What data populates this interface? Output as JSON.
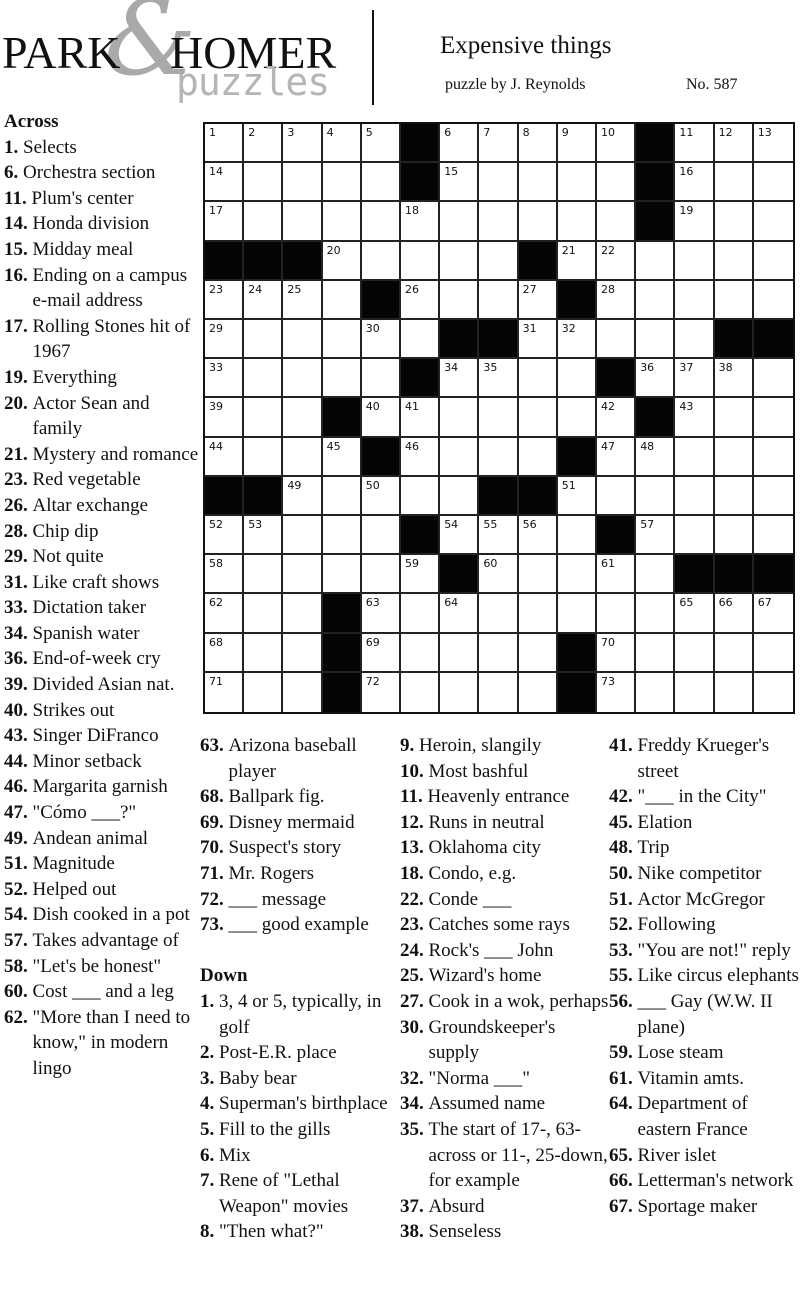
{
  "header": {
    "logo_park": "PARK",
    "logo_amp": "&",
    "logo_homer": "HOMER",
    "logo_puzzles": "puzzles",
    "title": "Expensive things",
    "byline": "puzzle by J. Reynolds",
    "puzzle_number": "No. 587"
  },
  "colors": {
    "black_square": "#050505",
    "logo_gray": "#a9a9a9"
  },
  "grid": {
    "size": 15,
    "blacks": [
      [
        0,
        5
      ],
      [
        0,
        11
      ],
      [
        1,
        5
      ],
      [
        1,
        11
      ],
      [
        2,
        11
      ],
      [
        3,
        0
      ],
      [
        3,
        1
      ],
      [
        3,
        2
      ],
      [
        3,
        8
      ],
      [
        4,
        4
      ],
      [
        4,
        9
      ],
      [
        5,
        6
      ],
      [
        5,
        7
      ],
      [
        5,
        13
      ],
      [
        5,
        14
      ],
      [
        6,
        5
      ],
      [
        6,
        10
      ],
      [
        7,
        3
      ],
      [
        7,
        11
      ],
      [
        8,
        4
      ],
      [
        8,
        9
      ],
      [
        9,
        0
      ],
      [
        9,
        1
      ],
      [
        9,
        7
      ],
      [
        9,
        8
      ],
      [
        10,
        5
      ],
      [
        10,
        10
      ],
      [
        11,
        6
      ],
      [
        11,
        12
      ],
      [
        11,
        13
      ],
      [
        11,
        14
      ],
      [
        12,
        3
      ],
      [
        13,
        3
      ],
      [
        13,
        9
      ],
      [
        14,
        3
      ],
      [
        14,
        9
      ]
    ],
    "numbers": [
      [
        0,
        0,
        1
      ],
      [
        0,
        1,
        2
      ],
      [
        0,
        2,
        3
      ],
      [
        0,
        3,
        4
      ],
      [
        0,
        4,
        5
      ],
      [
        0,
        6,
        6
      ],
      [
        0,
        7,
        7
      ],
      [
        0,
        8,
        8
      ],
      [
        0,
        9,
        9
      ],
      [
        0,
        10,
        10
      ],
      [
        0,
        12,
        11
      ],
      [
        0,
        13,
        12
      ],
      [
        0,
        14,
        13
      ],
      [
        1,
        0,
        14
      ],
      [
        1,
        6,
        15
      ],
      [
        1,
        12,
        16
      ],
      [
        2,
        0,
        17
      ],
      [
        2,
        5,
        18
      ],
      [
        2,
        12,
        19
      ],
      [
        3,
        3,
        20
      ],
      [
        3,
        9,
        21
      ],
      [
        3,
        10,
        22
      ],
      [
        4,
        0,
        23
      ],
      [
        4,
        1,
        24
      ],
      [
        4,
        2,
        25
      ],
      [
        4,
        5,
        26
      ],
      [
        4,
        8,
        27
      ],
      [
        4,
        10,
        28
      ],
      [
        5,
        0,
        29
      ],
      [
        5,
        4,
        30
      ],
      [
        5,
        8,
        31
      ],
      [
        5,
        9,
        32
      ],
      [
        6,
        0,
        33
      ],
      [
        6,
        6,
        34
      ],
      [
        6,
        7,
        35
      ],
      [
        6,
        11,
        36
      ],
      [
        6,
        12,
        37
      ],
      [
        6,
        13,
        38
      ],
      [
        7,
        0,
        39
      ],
      [
        7,
        4,
        40
      ],
      [
        7,
        5,
        41
      ],
      [
        7,
        10,
        42
      ],
      [
        7,
        12,
        43
      ],
      [
        8,
        0,
        44
      ],
      [
        8,
        3,
        45
      ],
      [
        8,
        5,
        46
      ],
      [
        8,
        10,
        47
      ],
      [
        8,
        11,
        48
      ],
      [
        9,
        2,
        49
      ],
      [
        9,
        4,
        50
      ],
      [
        9,
        9,
        51
      ],
      [
        10,
        0,
        52
      ],
      [
        10,
        1,
        53
      ],
      [
        10,
        6,
        54
      ],
      [
        10,
        7,
        55
      ],
      [
        10,
        8,
        56
      ],
      [
        10,
        11,
        57
      ],
      [
        11,
        0,
        58
      ],
      [
        11,
        5,
        59
      ],
      [
        11,
        7,
        60
      ],
      [
        11,
        10,
        61
      ],
      [
        12,
        0,
        62
      ],
      [
        12,
        4,
        63
      ],
      [
        12,
        6,
        64
      ],
      [
        12,
        12,
        65
      ],
      [
        12,
        13,
        66
      ],
      [
        12,
        14,
        67
      ],
      [
        13,
        0,
        68
      ],
      [
        13,
        4,
        69
      ],
      [
        13,
        10,
        70
      ],
      [
        14,
        0,
        71
      ],
      [
        14,
        4,
        72
      ],
      [
        14,
        10,
        73
      ]
    ]
  },
  "across_heading": "Across",
  "down_heading": "Down",
  "columns": [
    [
      {
        "h": "Across"
      },
      {
        "n": "1.",
        "t": "Selects"
      },
      {
        "n": "6.",
        "t": "Orchestra section"
      },
      {
        "n": "11.",
        "t": "Plum's center"
      },
      {
        "n": "14.",
        "t": "Honda division"
      },
      {
        "n": "15.",
        "t": "Midday meal"
      },
      {
        "n": "16.",
        "t": "Ending on a campus e-mail address"
      },
      {
        "n": "17.",
        "t": "Rolling Stones hit of 1967"
      },
      {
        "n": "19.",
        "t": "Everything"
      },
      {
        "n": "20.",
        "t": "Actor Sean and family"
      },
      {
        "n": "21.",
        "t": "Mystery and romance"
      },
      {
        "n": "23.",
        "t": "Red vegetable"
      },
      {
        "n": "26.",
        "t": "Altar exchange"
      },
      {
        "n": "28.",
        "t": "Chip dip"
      },
      {
        "n": "29.",
        "t": "Not quite"
      },
      {
        "n": "31.",
        "t": "Like craft shows"
      },
      {
        "n": "33.",
        "t": "Dictation taker"
      },
      {
        "n": "34.",
        "t": "Spanish water"
      },
      {
        "n": "36.",
        "t": "End-of-week cry"
      },
      {
        "n": "39.",
        "t": "Divided Asian nat."
      },
      {
        "n": "40.",
        "t": "Strikes out"
      },
      {
        "n": "43.",
        "t": "Singer DiFranco"
      },
      {
        "n": "44.",
        "t": "Minor setback"
      },
      {
        "n": "46.",
        "t": "Margarita garnish"
      },
      {
        "n": "47.",
        "t": "\"Cómo ___?\""
      },
      {
        "n": "49.",
        "t": "Andean animal"
      },
      {
        "n": "51.",
        "t": "Magnitude"
      },
      {
        "n": "52.",
        "t": "Helped out"
      },
      {
        "n": "54.",
        "t": "Dish cooked in a pot"
      },
      {
        "n": "57.",
        "t": "Takes advantage of"
      },
      {
        "n": "58.",
        "t": "\"Let's be honest\""
      },
      {
        "n": "60.",
        "t": "Cost ___ and a leg"
      },
      {
        "n": "62.",
        "t": "\"More than I need to know,\" in modern lingo"
      }
    ],
    [
      {
        "n": "63.",
        "t": "Arizona baseball player"
      },
      {
        "n": "68.",
        "t": "Ballpark fig."
      },
      {
        "n": "69.",
        "t": "Disney mermaid"
      },
      {
        "n": "70.",
        "t": "Suspect's story"
      },
      {
        "n": "71.",
        "t": "Mr. Rogers"
      },
      {
        "n": "72.",
        "t": "___ message"
      },
      {
        "n": "73.",
        "t": "___ good example"
      },
      {
        "gap": true
      },
      {
        "h": "Down"
      },
      {
        "n": "1.",
        "t": "3, 4 or 5, typically, in golf"
      },
      {
        "n": "2.",
        "t": "Post-E.R. place"
      },
      {
        "n": "3.",
        "t": "Baby bear"
      },
      {
        "n": "4.",
        "t": "Superman's birthplace"
      },
      {
        "n": "5.",
        "t": "Fill to the gills"
      },
      {
        "n": "6.",
        "t": "Mix"
      },
      {
        "n": "7.",
        "t": "Rene of \"Lethal Weapon\" movies"
      },
      {
        "n": "8.",
        "t": "\"Then what?\""
      }
    ],
    [
      {
        "n": "9.",
        "t": "Heroin, slangily"
      },
      {
        "n": "10.",
        "t": "Most bashful"
      },
      {
        "n": "11.",
        "t": "Heavenly entrance"
      },
      {
        "n": "12.",
        "t": "Runs in neutral"
      },
      {
        "n": "13.",
        "t": "Oklahoma city"
      },
      {
        "n": "18.",
        "t": "Condo, e.g."
      },
      {
        "n": "22.",
        "t": "Conde ___"
      },
      {
        "n": "23.",
        "t": "Catches some rays"
      },
      {
        "n": "24.",
        "t": "Rock's ___ John"
      },
      {
        "n": "25.",
        "t": "Wizard's home"
      },
      {
        "n": "27.",
        "t": "Cook in a wok, perhaps"
      },
      {
        "n": "30.",
        "t": "Groundskeeper's supply"
      },
      {
        "n": "32.",
        "t": "\"Norma ___\""
      },
      {
        "n": "34.",
        "t": "Assumed name"
      },
      {
        "n": "35.",
        "t": "The start of 17-, 63-across or 11-, 25-down, for example"
      },
      {
        "n": "37.",
        "t": "Absurd"
      },
      {
        "n": "38.",
        "t": "Senseless"
      }
    ],
    [
      {
        "n": "41.",
        "t": "Freddy Krueger's street"
      },
      {
        "n": "42.",
        "t": "\"___ in the City\""
      },
      {
        "n": "45.",
        "t": "Elation"
      },
      {
        "n": "48.",
        "t": "Trip"
      },
      {
        "n": "50.",
        "t": "Nike competitor"
      },
      {
        "n": "51.",
        "t": "Actor McGregor"
      },
      {
        "n": "52.",
        "t": "Following"
      },
      {
        "n": "53.",
        "t": "\"You are not!\" reply"
      },
      {
        "n": "55.",
        "t": "Like circus elephants"
      },
      {
        "n": "56.",
        "t": "___ Gay (W.W. II plane)"
      },
      {
        "n": "59.",
        "t": "Lose steam"
      },
      {
        "n": "61.",
        "t": "Vitamin amts."
      },
      {
        "n": "64.",
        "t": "Department of eastern France"
      },
      {
        "n": "65.",
        "t": "River islet"
      },
      {
        "n": "66.",
        "t": "Letterman's network"
      },
      {
        "n": "67.",
        "t": "Sportage maker"
      }
    ]
  ]
}
